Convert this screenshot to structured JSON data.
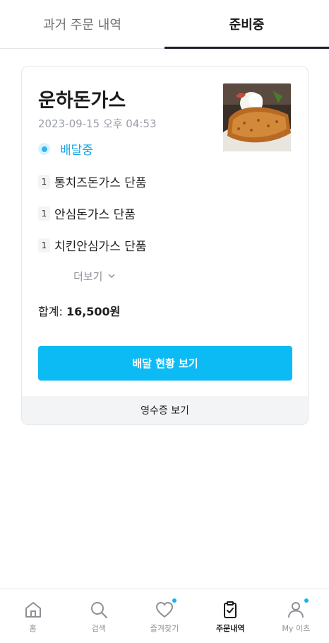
{
  "tabs": [
    {
      "label": "과거 주문 내역",
      "active": false
    },
    {
      "label": "준비중",
      "active": true
    }
  ],
  "order": {
    "store_name": "운하돈가스",
    "datetime": "2023-09-15 오후 04:53",
    "status": "배달중",
    "items": [
      {
        "qty": "1",
        "name": "통치즈돈가스 단품"
      },
      {
        "qty": "1",
        "name": "안심돈가스 단품"
      },
      {
        "qty": "1",
        "name": "치킨안심가스 단품"
      }
    ],
    "more_label": "더보기",
    "total_label": "합계:",
    "total_value": "16,500원",
    "track_button": "배달 현황 보기",
    "receipt_button": "영수증 보기"
  },
  "nav": [
    {
      "label": "홈",
      "icon": "home-icon",
      "active": false
    },
    {
      "label": "검색",
      "icon": "search-icon",
      "active": false
    },
    {
      "label": "즐겨찾기",
      "icon": "heart-icon",
      "active": false,
      "dot": true
    },
    {
      "label": "주문내역",
      "icon": "order-list-icon",
      "active": true
    },
    {
      "label": "My 이츠",
      "icon": "user-icon",
      "active": false,
      "dot": true
    }
  ],
  "colors": {
    "accent": "#0dbbf4",
    "status": "#17a6e0",
    "badge": "#19b2ef"
  }
}
